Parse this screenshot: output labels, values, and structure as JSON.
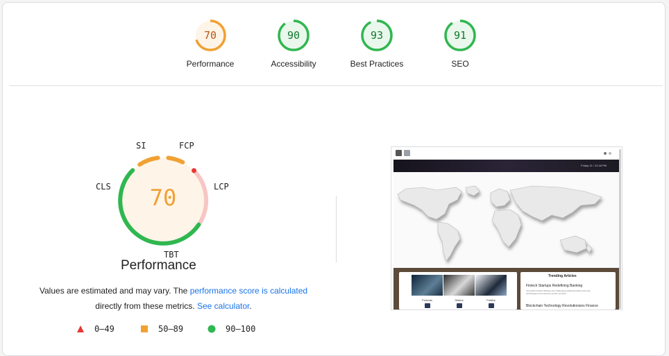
{
  "categories": [
    {
      "label": "Performance",
      "score": 70,
      "color": "#f0a133",
      "bg": "#fff4e8",
      "text": "#c0540d"
    },
    {
      "label": "Accessibility",
      "score": 90,
      "color": "#30b750",
      "bg": "#eaf7ec",
      "text": "#0f7a2c"
    },
    {
      "label": "Best Practices",
      "score": 93,
      "color": "#30b750",
      "bg": "#eaf7ec",
      "text": "#0f7a2c"
    },
    {
      "label": "SEO",
      "score": 91,
      "color": "#30b750",
      "bg": "#eaf7ec",
      "text": "#0f7a2c"
    }
  ],
  "performance": {
    "score": 70,
    "title": "Performance",
    "metrics": {
      "si": "SI",
      "fcp": "FCP",
      "lcp": "LCP",
      "tbt": "TBT",
      "cls": "CLS"
    },
    "description": {
      "text1": "Values are estimated and may vary. The",
      "link1": "performance score is calculated",
      "text2": "directly from these metrics.",
      "link2": "See calculator",
      "text3": "."
    }
  },
  "legend": [
    {
      "shape": "triangle",
      "range": "0–49",
      "color": "#e53935"
    },
    {
      "shape": "square",
      "range": "50–89",
      "color": "#f0a133"
    },
    {
      "shape": "circle",
      "range": "90–100",
      "color": "#30b750"
    }
  ],
  "screenshot": {
    "banner_text": "Friday 11 / 13 48 PM",
    "photo_labels": [
      "Protests",
      "Strikes",
      "Politics"
    ],
    "trending_title": "Trending Articles",
    "article1_title": "Fintech Startups Redefining Banking",
    "article1_text": "Innovative Fintech Startups are challenging traditional banks with new technologies and customer-centric services.",
    "article2_title": "Blockchain Technology Revolutionizes Finance"
  }
}
